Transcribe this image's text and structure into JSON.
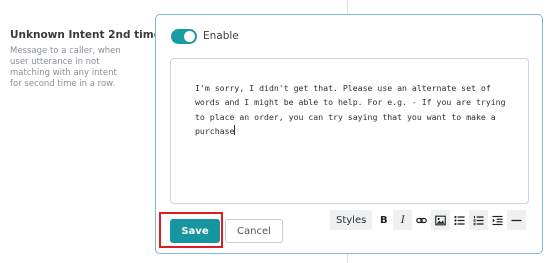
{
  "setting": {
    "title": "Unknown Intent 2nd time",
    "description": "Message to a caller, when user utterance in not matching with any intent for second time in a row."
  },
  "toggle": {
    "label": "Enable",
    "enabled": true
  },
  "editor": {
    "text": "I'm sorry, I didn't get that. Please use an alternate set of words and I might be able to help. For e.g. - If you are trying to place an order, you can try saying that you want to make a purchase"
  },
  "buttons": {
    "save": "Save",
    "cancel": "Cancel"
  },
  "toolbar": {
    "styles_label": "Styles",
    "bold": "B",
    "italic": "I",
    "icons": [
      "link-icon",
      "image-icon",
      "bulleted-list-icon",
      "numbered-list-icon",
      "indent-icon",
      "horizontal-rule-icon"
    ]
  },
  "colors": {
    "accent": "#1796a1",
    "highlight": "#e11b22",
    "card_border": "#7fb8d0"
  }
}
